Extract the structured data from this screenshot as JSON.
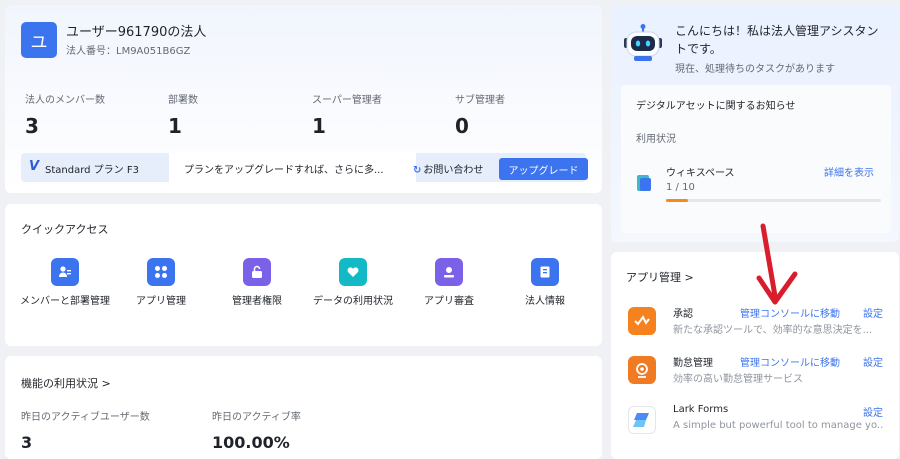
{
  "org": {
    "avatar_initial": "ユ",
    "name": "ユーザー961790の法人",
    "number": "法人番号：LM9A051B6GZ",
    "stats": [
      {
        "label": "法人のメンバー数",
        "value": "3"
      },
      {
        "label": "部署数",
        "value": "1"
      },
      {
        "label": "スーパー管理者",
        "value": "1"
      },
      {
        "label": "サブ管理者",
        "value": "0"
      }
    ],
    "plan": {
      "logo": "V",
      "name": "Standard プラン F3",
      "message": "プランをアップグレードすれば、さらに多...",
      "contact": "お問い合わせ",
      "upgrade": "アップグレード"
    }
  },
  "quick_access": {
    "title": "クイックアクセス",
    "items": [
      {
        "label": "メンバーと部署管理",
        "icon": "member-department-icon",
        "color": "#3c74f0"
      },
      {
        "label": "アプリ管理",
        "icon": "app-grid-icon",
        "color": "#3c74f0"
      },
      {
        "label": "管理者権限",
        "icon": "unlock-icon",
        "color": "#7b61e8"
      },
      {
        "label": "データの利用状況",
        "icon": "data-heart-icon",
        "color": "#14b9c6"
      },
      {
        "label": "アプリ審査",
        "icon": "app-review-icon",
        "color": "#7b61e8"
      },
      {
        "label": "法人情報",
        "icon": "org-info-icon",
        "color": "#3c74f0"
      }
    ]
  },
  "usage": {
    "title": "機能の利用状況 >",
    "stats": [
      {
        "label": "昨日のアクティブユーザー数",
        "value": "3"
      },
      {
        "label": "昨日のアクティブ率",
        "value": "100.00%"
      }
    ]
  },
  "assistant": {
    "greeting": "こんにちは！私は法人管理アシスタントです。",
    "subtitle": "現在、処理待ちのタスクがあります",
    "notice_title": "デジタルアセットに関するお知らせ",
    "usage_label": "利用状況",
    "wiki": {
      "name": "ウィキスペース",
      "detail": "詳細を表示",
      "count": "1 / 10",
      "fraction": 0.1
    }
  },
  "apps": {
    "title": "アプリ管理 >",
    "items": [
      {
        "name": "承認",
        "console": "管理コンソールに移動",
        "settings": "設定",
        "desc": "新たな承認ツールで、効率的な意思決定を...",
        "color": "#f5811f",
        "icon": "approval-icon"
      },
      {
        "name": "勤怠管理",
        "console": "管理コンソールに移動",
        "settings": "設定",
        "desc": "効率の高い勤怠管理サービス",
        "color": "#f07b22",
        "icon": "attendance-icon"
      },
      {
        "name": "Lark Forms",
        "console": "",
        "settings": "設定",
        "desc": "A simple but powerful tool to manage yo...",
        "color": "#4a8bf5",
        "icon": "lark-forms-icon"
      }
    ]
  }
}
